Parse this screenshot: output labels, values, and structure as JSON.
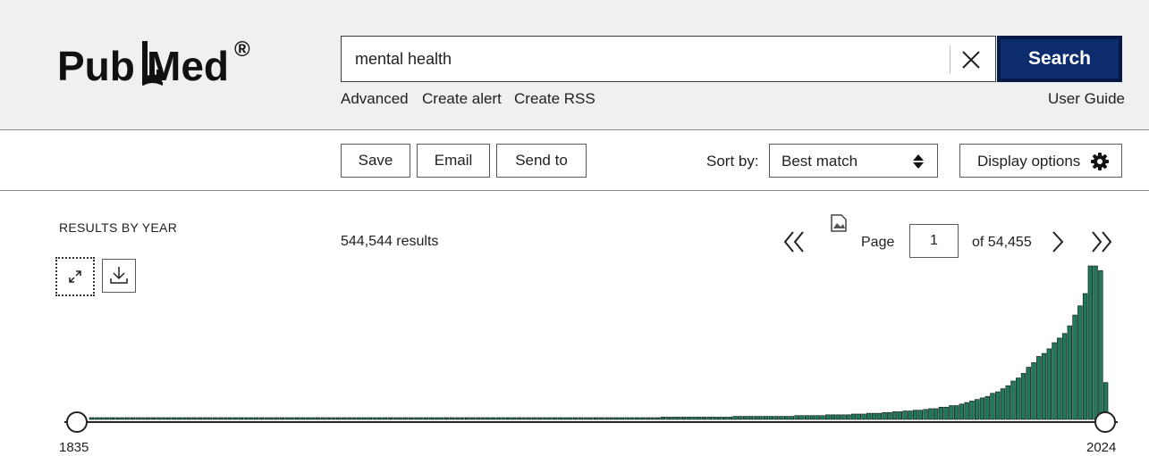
{
  "header": {
    "logo_pub": "Pub",
    "logo_med": "Med",
    "logo_reg": "®",
    "search_value": "mental health",
    "search_button": "Search",
    "links": {
      "advanced": "Advanced",
      "create_alert": "Create alert",
      "create_rss": "Create RSS",
      "user_guide": "User Guide"
    }
  },
  "toolbar": {
    "save": "Save",
    "email": "Email",
    "send_to": "Send to",
    "sort_label": "Sort by:",
    "sort_value": "Best match",
    "display_options": "Display options"
  },
  "results": {
    "by_year_title": "RESULTS BY YEAR",
    "count": "544,544 results",
    "page_label": "Page",
    "page_value": "1",
    "of_pages": "of 54,455"
  },
  "icons": [
    "close-icon",
    "sort-updown-icon",
    "gear-icon",
    "collapse-icon",
    "download-icon",
    "double-chevron-left-icon",
    "broken-image-icon",
    "chevron-right-icon",
    "double-chevron-right-icon"
  ],
  "colors": {
    "search_button": "#0d2c6e",
    "bar": "#1e7a5a",
    "header_bg": "#f0f0f0"
  },
  "chart_data": {
    "type": "bar",
    "x_start_label": "1835",
    "x_end_label": "2024",
    "x_range": [
      1835,
      2024
    ],
    "values_relative": [
      0.01,
      0.01,
      0.01,
      0.01,
      0.01,
      0.01,
      0.01,
      0.01,
      0.01,
      0.01,
      0.01,
      0.01,
      0.01,
      0.01,
      0.01,
      0.01,
      0.01,
      0.01,
      0.01,
      0.01,
      0.01,
      0.01,
      0.01,
      0.01,
      0.01,
      0.01,
      0.01,
      0.01,
      0.01,
      0.01,
      0.01,
      0.01,
      0.01,
      0.01,
      0.01,
      0.01,
      0.01,
      0.01,
      0.01,
      0.01,
      0.01,
      0.01,
      0.01,
      0.01,
      0.01,
      0.01,
      0.01,
      0.01,
      0.01,
      0.01,
      0.01,
      0.01,
      0.01,
      0.01,
      0.01,
      0.01,
      0.01,
      0.01,
      0.01,
      0.01,
      0.01,
      0.01,
      0.01,
      0.01,
      0.01,
      0.01,
      0.01,
      0.01,
      0.01,
      0.01,
      0.01,
      0.01,
      0.01,
      0.01,
      0.01,
      0.01,
      0.01,
      0.01,
      0.01,
      0.01,
      0.01,
      0.01,
      0.01,
      0.01,
      0.01,
      0.01,
      0.01,
      0.01,
      0.01,
      0.01,
      0.01,
      0.01,
      0.01,
      0.01,
      0.01,
      0.01,
      0.01,
      0.01,
      0.01,
      0.01,
      0.01,
      0.01,
      0.01,
      0.01,
      0.01,
      0.01,
      0.01,
      0.01,
      0.01,
      0.01,
      0.01,
      0.015,
      0.015,
      0.015,
      0.015,
      0.015,
      0.015,
      0.015,
      0.015,
      0.015,
      0.015,
      0.015,
      0.015,
      0.015,
      0.015,
      0.02,
      0.02,
      0.02,
      0.02,
      0.02,
      0.02,
      0.02,
      0.02,
      0.02,
      0.02,
      0.02,
      0.02,
      0.025,
      0.025,
      0.025,
      0.025,
      0.025,
      0.025,
      0.03,
      0.03,
      0.03,
      0.03,
      0.03,
      0.035,
      0.035,
      0.035,
      0.04,
      0.04,
      0.04,
      0.045,
      0.045,
      0.05,
      0.05,
      0.055,
      0.055,
      0.06,
      0.06,
      0.065,
      0.07,
      0.07,
      0.08,
      0.08,
      0.09,
      0.09,
      0.1,
      0.11,
      0.12,
      0.13,
      0.14,
      0.15,
      0.17,
      0.18,
      0.2,
      0.22,
      0.25,
      0.27,
      0.3,
      0.34,
      0.37,
      0.41,
      0.43,
      0.46,
      0.5,
      0.53,
      0.56,
      0.61,
      0.68,
      0.74,
      0.82,
      1.0,
      1.0,
      0.97,
      0.24
    ]
  }
}
